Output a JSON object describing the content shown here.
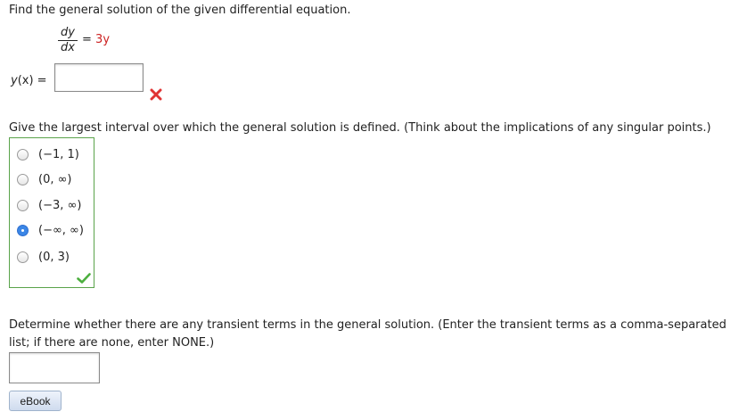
{
  "question1": {
    "instruction": "Find the general solution of the given differential equation.",
    "equation": {
      "numerator": "dy",
      "denominator": "dx",
      "equals": "=",
      "rhs": "3y"
    },
    "answer_label_func": "y",
    "answer_label_arg": "(x) =",
    "answer_value": "",
    "status": "incorrect",
    "status_icon": "x-mark-icon",
    "status_color": "#e03333"
  },
  "question2": {
    "prompt": "Give the largest interval over which the general solution is defined. (Think about the implications of any singular points.)",
    "options": [
      {
        "label": "(−1, 1)",
        "selected": false
      },
      {
        "label": "(0, ∞)",
        "selected": false
      },
      {
        "label": "(−3, ∞)",
        "selected": false
      },
      {
        "label": "(−∞, ∞)",
        "selected": true
      },
      {
        "label": "(0, 3)",
        "selected": false
      }
    ],
    "status": "correct",
    "status_icon": "checkmark-icon",
    "status_color": "#4caf3e",
    "frame_color": "#5aa34a"
  },
  "question3": {
    "prompt": "Determine whether there are any transient terms in the general solution. (Enter the transient terms as a comma-separated list; if there are none, enter NONE.)",
    "answer_value": ""
  },
  "ebook": {
    "label": "eBook"
  },
  "colors": {
    "accent_red": "#cc2222",
    "radio_selected": "#3b86e6"
  }
}
